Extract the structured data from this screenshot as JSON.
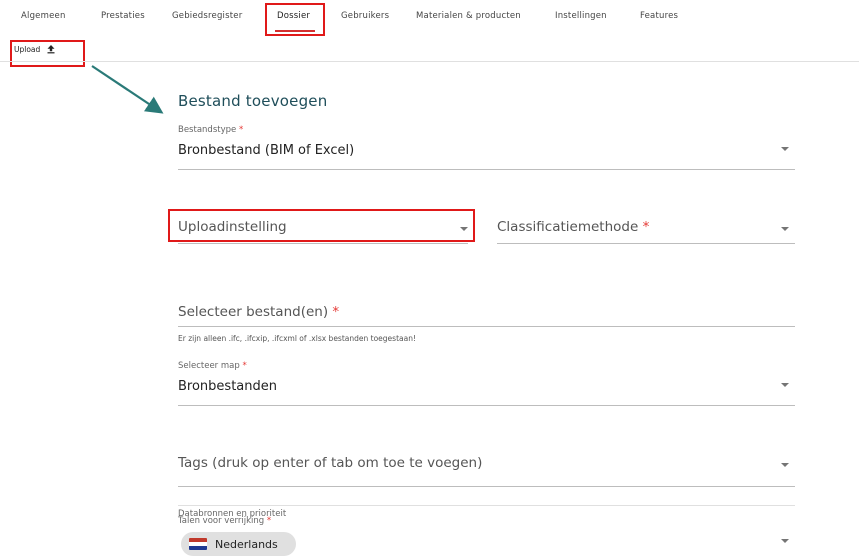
{
  "nav": {
    "tabs": [
      {
        "label": "Algemeen"
      },
      {
        "label": "Prestaties"
      },
      {
        "label": "Gebiedsregister"
      },
      {
        "label": "Dossier",
        "active": true
      },
      {
        "label": "Gebruikers"
      },
      {
        "label": "Materialen & producten"
      },
      {
        "label": "Instellingen"
      },
      {
        "label": "Features"
      }
    ]
  },
  "toolbar": {
    "upload_label": "Upload",
    "upload_icon": "upload-icon"
  },
  "form": {
    "title": "Bestand toevoegen",
    "bestandstype": {
      "label": "Bestandstype",
      "required_mark": "*",
      "value": "Bronbestand (BIM of Excel)"
    },
    "uploadinstelling": {
      "placeholder": "Uploadinstelling"
    },
    "classificatiemethode": {
      "placeholder": "Classificatiemethode",
      "required_mark": "*"
    },
    "bestanden": {
      "placeholder": "Selecteer bestand(en)",
      "required_mark": "*",
      "hint": "Er zijn alleen .ifc, .ifcxip, .ifcxml of .xlsx bestanden toegestaan!"
    },
    "map": {
      "label": "Selecteer map",
      "required_mark": "*",
      "value": "Bronbestanden"
    },
    "tags": {
      "placeholder": "Tags (druk op enter of tab om toe te voegen)"
    },
    "databronnen": {
      "label": "Databronnen en prioriteit"
    },
    "talen": {
      "label": "Talen voor verrijking",
      "required_mark": "*",
      "chip": "Nederlands"
    }
  },
  "colors": {
    "highlight": "#e01919",
    "arrow": "#2a7a78",
    "title": "#1f4e5a",
    "required": "#e53935"
  }
}
